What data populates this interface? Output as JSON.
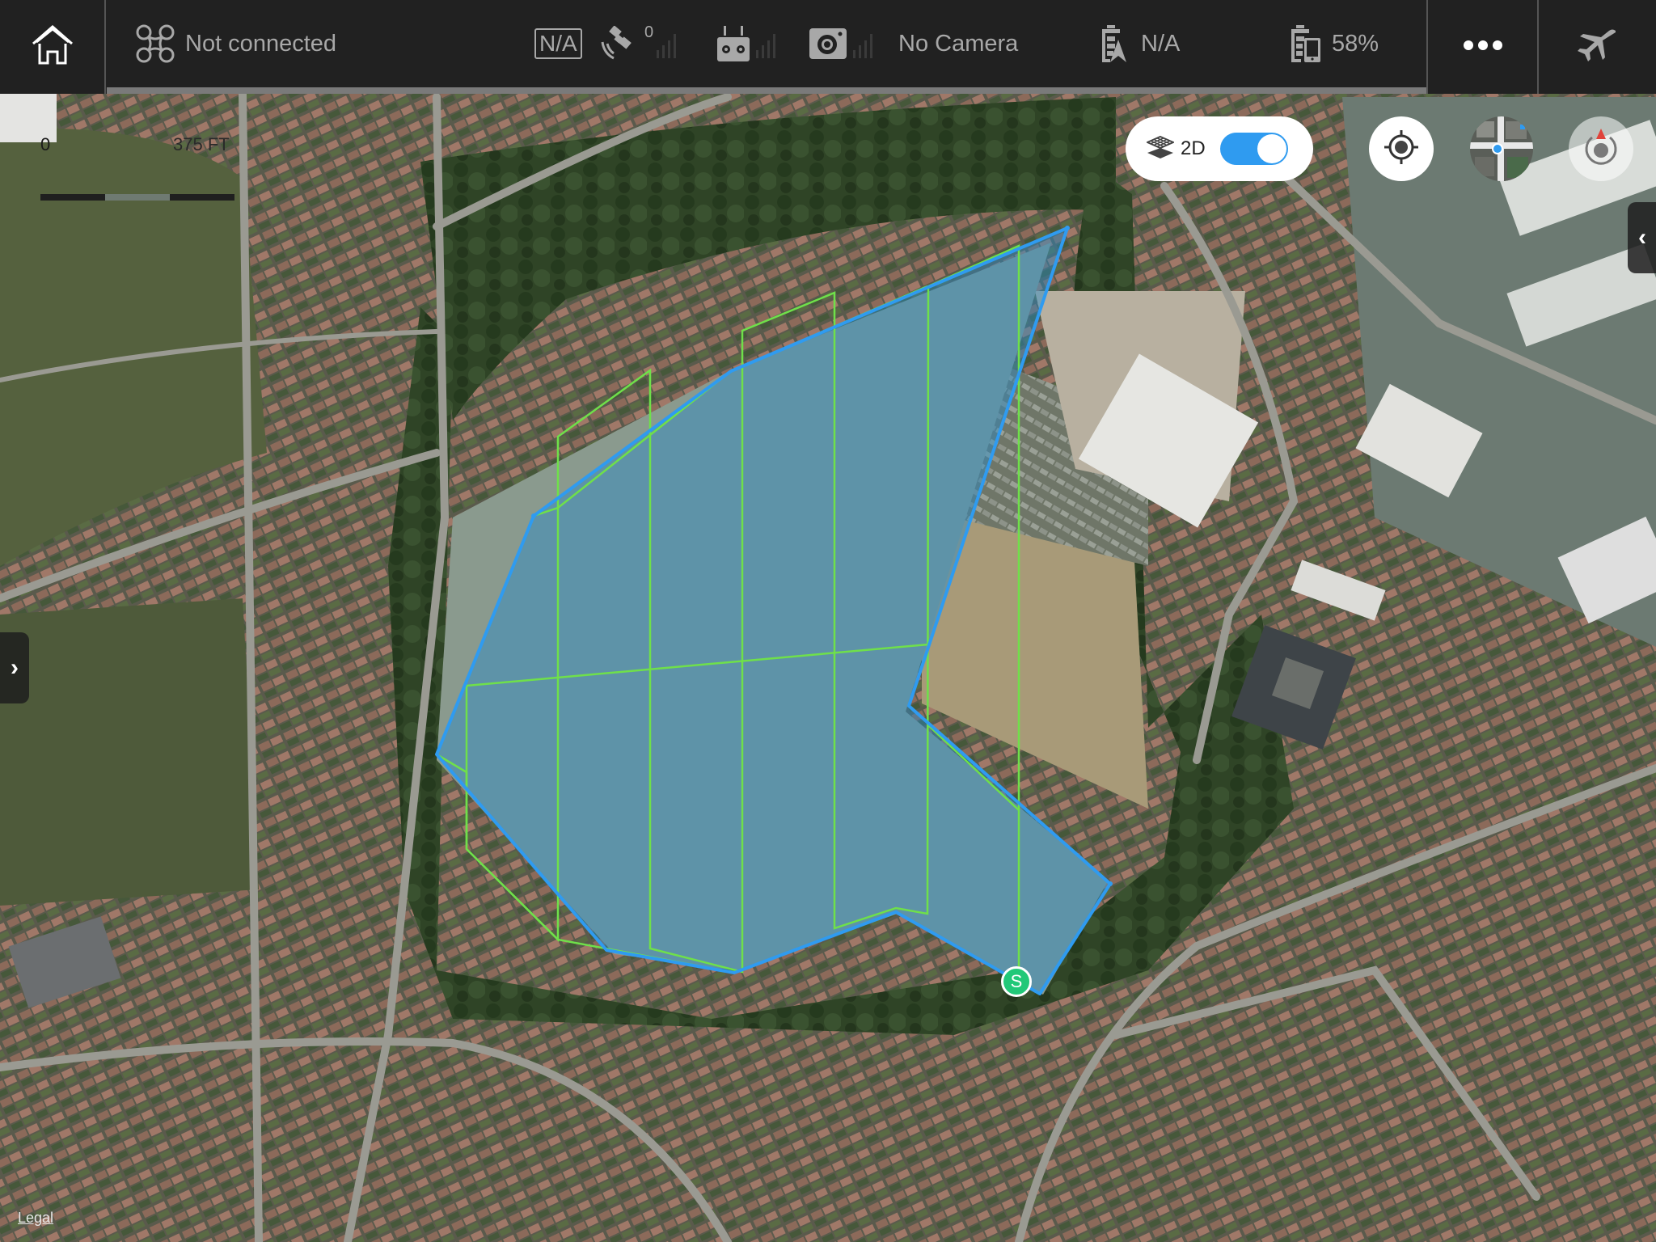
{
  "topbar": {
    "home_icon": "home-icon",
    "aircraft": {
      "icon": "drone-icon",
      "status": "Not connected"
    },
    "flight_mode": {
      "label": "N/A"
    },
    "gps": {
      "icon": "satellite-icon",
      "count": "0"
    },
    "remote": {
      "icon": "remote-controller-icon"
    },
    "camera": {
      "icon": "camera-icon",
      "label": "No Camera"
    },
    "aircraft_battery": {
      "icon": "aircraft-battery-icon",
      "value": "N/A"
    },
    "device_battery": {
      "icon": "device-battery-icon",
      "value": "58%"
    },
    "more_icon": "more-icon",
    "fly_icon": "airplane-icon"
  },
  "map": {
    "scale": {
      "start": "0",
      "end": "375 FT"
    },
    "view_toggle": {
      "label": "2D",
      "on": true
    },
    "controls": {
      "locate_icon": "crosshair-icon",
      "compass_icon": "compass-icon"
    },
    "left_panel_toggle": "›",
    "right_panel_toggle": "‹",
    "legal_label": "Legal",
    "start_marker_label": "S",
    "colors": {
      "boundary": "#2f9bf0",
      "flight_path": "#6fe04a",
      "fill": "rgba(40,140,200,0.45)",
      "start_marker": "#21c878",
      "toggle_on": "#2f9bf0"
    }
  }
}
